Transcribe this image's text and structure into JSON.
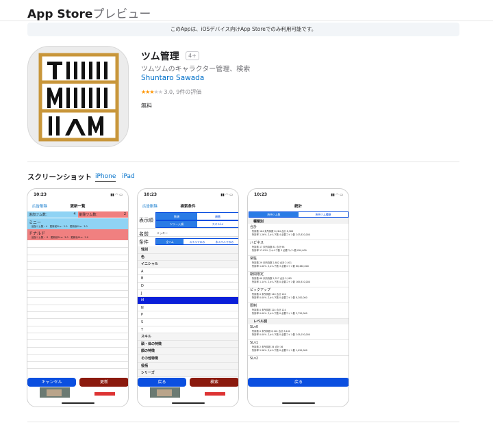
{
  "header": {
    "brand": "App Store",
    "subtitle": "プレビュー"
  },
  "notice": "このAppは、iOSデバイス向けApp Storeでのみ利用可能です。",
  "app": {
    "title": "ツム管理",
    "age": "4+",
    "subtitle": "ツムツムのキャラクター管理、検索",
    "developer": "Shuntaro Sawada",
    "rating_text": "3.0, 9件の評価",
    "rating_value": 3.0,
    "price": "無料",
    "icon_text": [
      "TIIIII",
      "MIIIII",
      "IIAM"
    ]
  },
  "screenshots": {
    "heading": "スクリーンショット",
    "tabs": [
      "iPhone",
      "iPad"
    ]
  },
  "phone1": {
    "time": "10:23",
    "nav_left": "広告削除",
    "nav_title": "更新一覧",
    "row1_left": "追加ツム数：",
    "row1_left_val": "4",
    "row1_right": "削除ツム数：",
    "row1_right_val": "2",
    "name1": "ミニー",
    "name1_detail": "追加ツム数：4　更新前SLv：2.0　更新後SLv：3.0",
    "name2": "ドナルド",
    "name2_detail": "追加ツム数：-2　更新前SLv：3.0　更新後SLv：2.0",
    "cancel": "キャンセル",
    "update": "更新"
  },
  "phone2": {
    "time": "10:23",
    "nav_left": "広告削除",
    "nav_title": "検索条件",
    "display_label": "表示順",
    "seg1": [
      "数順",
      "順番"
    ],
    "seg2": [
      "ツリー入順",
      "スキルLv"
    ],
    "name_label": "名前",
    "name_value": "ミッキー",
    "cond_label": "条件",
    "cond_seg": [
      "全ツム",
      "スキルマのみ",
      "未スキルマのみ"
    ],
    "items": [
      "性別",
      "色",
      "イニシャル",
      "A",
      "B",
      "D",
      "J",
      "M",
      "N",
      "P",
      "S",
      "T",
      "スキル",
      "頭・体の特徴",
      "顔の特徴",
      "その他特徴",
      "役柄",
      "シリーズ"
    ],
    "back": "戻る",
    "search": "検索"
  },
  "phone3": {
    "time": "10:23",
    "nav_title": "統計",
    "seg": [
      "所持ツム数",
      "所持ツム種類"
    ],
    "group1": "種類別",
    "sections": [
      "合計",
      "ハピネス",
      "常駐",
      "期間限定",
      "ピックアップ",
      "限制"
    ],
    "group2": "レベル別",
    "levels": [
      "SLv0",
      "SLv1",
      "SLv2"
    ],
    "data_lines": [
      [
        "所持数 164  未所持数 8,264  合計 8,368",
        "所持率 1.26%  スキル下数 4  必要コイン数 247,820,000"
      ],
      [
        "所持数 17  未所持数 81  合計 98",
        "所持率 17.02%  スキル下数 3  必要コイン数 810,000"
      ],
      [
        "所持数 29  未所持数 2,882  合計 2,911",
        "所持率 1.00%  スキル下数 3  必要コイン数 86,460,000"
      ],
      [
        "所持数 68  未所持数 5,527  合計 5,585",
        "所持率 1.14%  スキル下数 0  必要コイン数 165,810,000"
      ],
      [
        "所持数 0  未所持数 140  合計 140",
        "所持率 0.00%  スキル下数 0  必要コイン数 8,200,000"
      ],
      [
        "所持数 0  未所持数 124  合計 124",
        "所持率 0.00%  スキル下数 0  必要コイン数 3,720,000"
      ],
      [
        "所持数 0  未所持数 8,101  合計 8,101",
        "所持率 0.00%  スキル下数 0  必要コイン数 243,030,000"
      ],
      [
        "所持数 2  未所持数 34  合計 36",
        "所持率 5.56%  スキル下数 0  必要コイン数 1,020,000"
      ]
    ],
    "back": "戻る"
  },
  "colors": {
    "accent": "#0070c9",
    "ios_blue": "#0b4fe0",
    "red_row": "#f08080",
    "blue_row": "#8fd3f4",
    "dark_red": "#8b1a0e",
    "icon_gold": "#c8963a"
  }
}
